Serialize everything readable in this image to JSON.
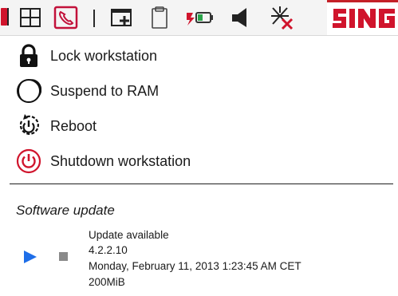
{
  "menu": {
    "items": [
      {
        "label": "Lock workstation",
        "icon": "lock-icon"
      },
      {
        "label": "Suspend to RAM",
        "icon": "moon-icon"
      },
      {
        "label": "Reboot",
        "icon": "reboot-icon"
      },
      {
        "label": "Shutdown workstation",
        "icon": "power-icon"
      }
    ]
  },
  "software_update": {
    "title": "Software update",
    "entry": {
      "status": "Update available",
      "version": "4.2.2.10",
      "date": "Monday, February 11, 2013 1:23:45 AM CET",
      "size": "200MiB"
    }
  },
  "tray": {
    "icons": [
      "red-bar-icon",
      "grid-icon",
      "phone-icon",
      "separator-icon",
      "add-window-icon",
      "clipboard-icon",
      "battery-charging-icon",
      "speaker-icon",
      "network-disconnected-icon",
      "brand-logo"
    ]
  },
  "colors": {
    "accent_red": "#d0142c",
    "play_blue": "#1e6ee8",
    "stop_gray": "#8a8a8a"
  }
}
